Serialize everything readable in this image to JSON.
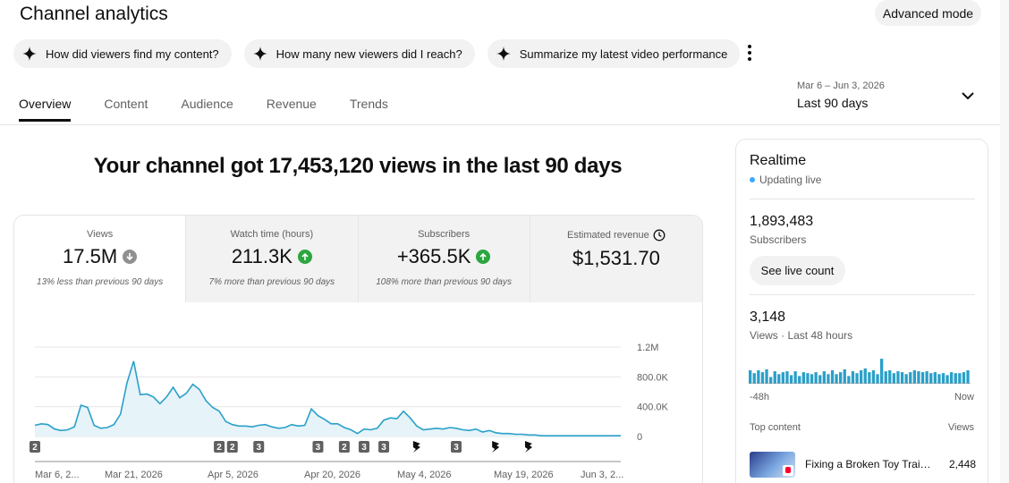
{
  "header": {
    "title": "Channel analytics",
    "advanced_mode": "Advanced mode"
  },
  "chips": [
    "How did viewers find my content?",
    "How many new viewers did I reach?",
    "Summarize my latest video performance"
  ],
  "tabs": [
    "Overview",
    "Content",
    "Audience",
    "Revenue",
    "Trends"
  ],
  "date": {
    "range": "Mar 6 – Jun 3, 2026",
    "label": "Last 90 days"
  },
  "headline": "Your channel got 17,453,120 views in the last 90 days",
  "metrics": [
    {
      "label": "Views",
      "value": "17.5M",
      "trend": "down",
      "note": "13% less than previous 90 days"
    },
    {
      "label": "Watch time (hours)",
      "value": "211.3K",
      "trend": "up",
      "note": "7% more than previous 90 days"
    },
    {
      "label": "Subscribers",
      "value": "+365.5K",
      "trend": "up",
      "note": "108% more than previous 90 days"
    },
    {
      "label": "Estimated revenue",
      "value": "$1,531.70",
      "trend": "none",
      "note": ""
    }
  ],
  "chart_data": {
    "type": "area",
    "series_name": "Views",
    "y_ticks": [
      "1.2M",
      "800.0K",
      "400.0K",
      "0"
    ],
    "ylim": [
      0,
      1200000
    ],
    "x_labels": [
      "Mar 6, 2...",
      "Mar 21, 2026",
      "Apr 5, 2026",
      "Apr 20, 2026",
      "May 4, 2026",
      "May 19, 2026",
      "Jun 3, 2..."
    ],
    "values": [
      150000,
      170000,
      160000,
      100000,
      80000,
      90000,
      130000,
      420000,
      390000,
      150000,
      110000,
      120000,
      160000,
      300000,
      720000,
      1010000,
      560000,
      570000,
      530000,
      440000,
      530000,
      660000,
      520000,
      580000,
      700000,
      630000,
      480000,
      390000,
      340000,
      200000,
      160000,
      140000,
      140000,
      130000,
      150000,
      160000,
      130000,
      110000,
      120000,
      160000,
      140000,
      150000,
      370000,
      280000,
      230000,
      170000,
      170000,
      120000,
      90000,
      40000,
      100000,
      90000,
      110000,
      220000,
      250000,
      240000,
      340000,
      250000,
      140000,
      90000,
      100000,
      110000,
      100000,
      120000,
      110000,
      90000,
      80000,
      100000,
      60000,
      80000,
      50000,
      40000,
      40000,
      30000,
      30000,
      20000,
      20000,
      10000,
      10000,
      10000,
      10000,
      10000,
      10000,
      10000,
      10000,
      10000,
      10000,
      10000,
      10000,
      10000
    ],
    "markers": [
      {
        "day": 0,
        "label": "2"
      },
      {
        "day": 28,
        "label": "2"
      },
      {
        "day": 30,
        "label": "2"
      },
      {
        "day": 34,
        "label": "3"
      },
      {
        "day": 43,
        "label": "3"
      },
      {
        "day": 47,
        "label": "2"
      },
      {
        "day": 50,
        "label": "3"
      },
      {
        "day": 53,
        "label": "3"
      },
      {
        "day": 58,
        "label": "shorts"
      },
      {
        "day": 64,
        "label": "3"
      },
      {
        "day": 70,
        "label": "shorts"
      },
      {
        "day": 75,
        "label": "shorts"
      }
    ],
    "colors": {
      "line": "#2aa0c9",
      "fill": "#e6f3f8",
      "marker": "#606060"
    }
  },
  "realtime": {
    "title": "Realtime",
    "status": "Updating live",
    "subscribers_value": "1,893,483",
    "subscribers_label": "Subscribers",
    "live_count_button": "See live count",
    "views_value": "3,148",
    "views_label": "Views · Last 48 hours",
    "bars": [
      14,
      11,
      14,
      12,
      15,
      7,
      13,
      10,
      12,
      13,
      9,
      13,
      8,
      12,
      11,
      10,
      12,
      9,
      13,
      10,
      14,
      10,
      12,
      15,
      8,
      13,
      11,
      14,
      16,
      12,
      14,
      10,
      26,
      13,
      14,
      11,
      13,
      12,
      10,
      12,
      14,
      13,
      12,
      13,
      11,
      12,
      10,
      11,
      9,
      12,
      11,
      11,
      12,
      14
    ],
    "axis_start": "-48h",
    "axis_end": "Now",
    "top_content_label": "Top content",
    "views_col_label": "Views",
    "top_content": [
      {
        "title": "Fixing a Broken Toy Train ...",
        "views": "2,448"
      }
    ],
    "colors": {
      "bar": "#2aa0c9",
      "live_dot": "#3ea6ff"
    }
  }
}
